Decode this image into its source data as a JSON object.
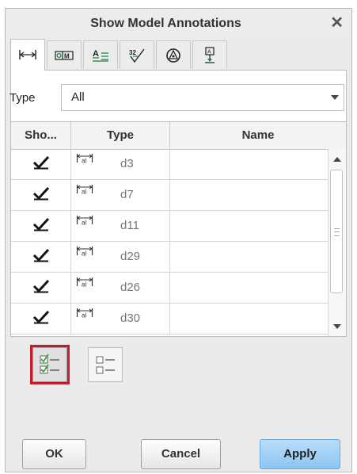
{
  "dialog": {
    "title": "Show Model Annotations",
    "close_symbol": "✕",
    "tabs": [
      {
        "name": "dimension-tab-icon",
        "active": true
      },
      {
        "name": "gtol-tab-icon",
        "active": false
      },
      {
        "name": "note-tab-icon",
        "active": false
      },
      {
        "name": "surface-finish-tab-icon",
        "active": false
      },
      {
        "name": "symbol-tab-icon",
        "active": false
      },
      {
        "name": "datum-tab-icon",
        "active": false
      }
    ],
    "filter": {
      "label": "Type",
      "value": "All"
    },
    "table": {
      "headers": {
        "show": "Sho...",
        "type": "Type",
        "name": "Name"
      },
      "rows": [
        {
          "checked": true,
          "type_icon": "dimension-icon",
          "name": "d3"
        },
        {
          "checked": true,
          "type_icon": "dimension-icon",
          "name": "d7"
        },
        {
          "checked": true,
          "type_icon": "dimension-icon",
          "name": "d11"
        },
        {
          "checked": true,
          "type_icon": "dimension-icon",
          "name": "d29"
        },
        {
          "checked": true,
          "type_icon": "dimension-icon",
          "name": "d26"
        },
        {
          "checked": true,
          "type_icon": "dimension-icon",
          "name": "d30"
        }
      ]
    },
    "buttons": {
      "ok": "OK",
      "cancel": "Cancel",
      "apply": "Apply"
    },
    "colors": {
      "accent": "#c21f2b",
      "apply_bg": "#8cc5f3",
      "check_green": "#3aa23a"
    }
  }
}
